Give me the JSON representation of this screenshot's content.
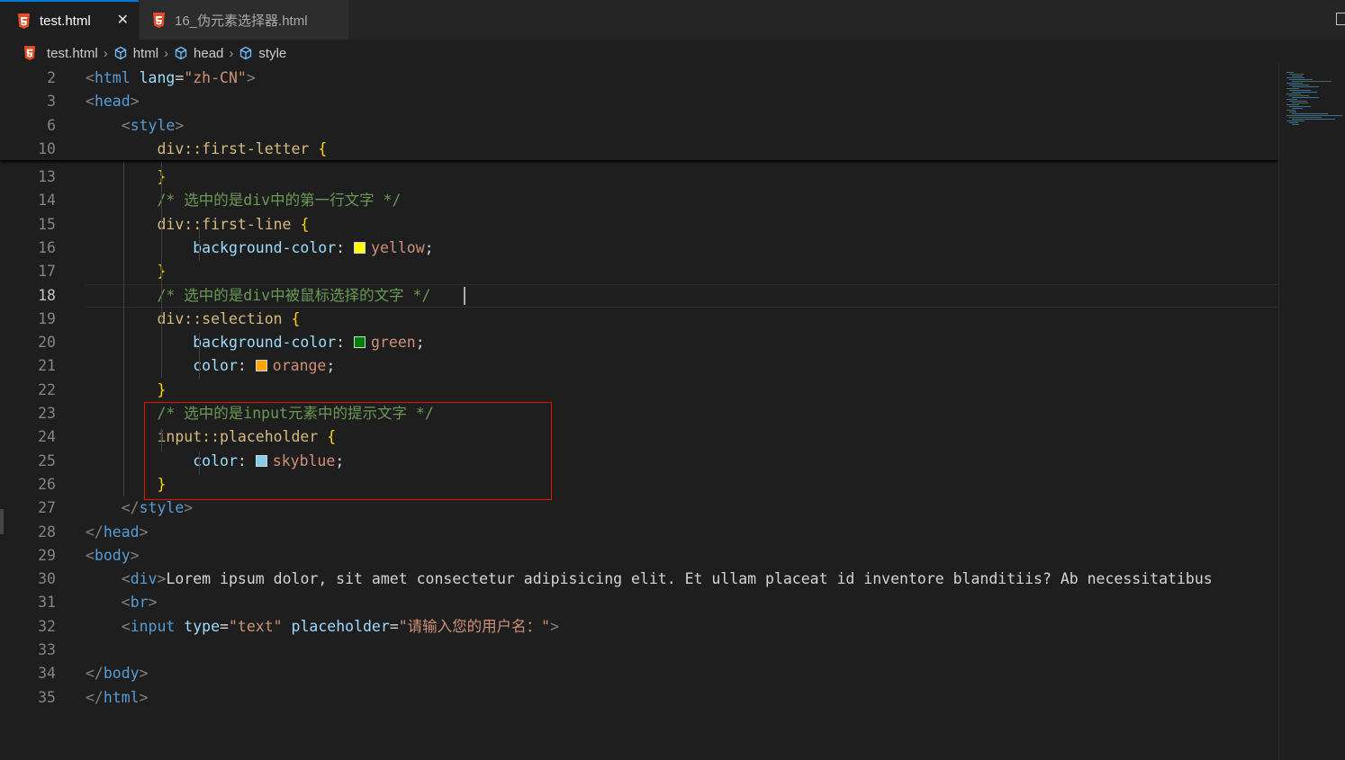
{
  "tabs": [
    {
      "label": "test.html",
      "active": true,
      "close": "✕"
    },
    {
      "label": "16_伪元素选择器.html",
      "active": false
    }
  ],
  "breadcrumb": {
    "file": "test.html",
    "items": [
      "html",
      "head",
      "style"
    ],
    "separator": "›"
  },
  "icons": {
    "file": "html5-icon",
    "symbol": "cube-icon",
    "close": "close-icon",
    "split": "split-editor-icon"
  },
  "colors": {
    "yellow": "#ffff00",
    "green": "#008000",
    "orange": "#ffa500",
    "skyblue": "#87ceeb",
    "accent": "#0078d4",
    "highlight_box": "#e51400"
  },
  "sticky_lines": [
    {
      "n": "2",
      "indent": "",
      "text": "<html lang=\"zh-CN\">"
    },
    {
      "n": "3",
      "indent": "",
      "text": "<head>"
    },
    {
      "n": "6",
      "indent": "    ",
      "text": "<style>"
    },
    {
      "n": "10",
      "indent": "        ",
      "text": "div::first-letter {"
    }
  ],
  "lines": [
    {
      "n": "13",
      "text": "        }"
    },
    {
      "n": "14",
      "text": "        /* 选中的是div中的第一行文字 */"
    },
    {
      "n": "15",
      "text": "        div::first-line {"
    },
    {
      "n": "16",
      "text": "            background-color: yellow;"
    },
    {
      "n": "17",
      "text": "        }"
    },
    {
      "n": "18",
      "text": "        /* 选中的是div中被鼠标选择的文字 */"
    },
    {
      "n": "19",
      "text": "        div::selection {"
    },
    {
      "n": "20",
      "text": "            background-color: green;"
    },
    {
      "n": "21",
      "text": "            color: orange;"
    },
    {
      "n": "22",
      "text": "        }"
    },
    {
      "n": "23",
      "text": "        /* 选中的是input元素中的提示文字 */"
    },
    {
      "n": "24",
      "text": "        input::placeholder {"
    },
    {
      "n": "25",
      "text": "            color: skyblue;"
    },
    {
      "n": "26",
      "text": "        }"
    },
    {
      "n": "27",
      "text": "    </style>"
    },
    {
      "n": "28",
      "text": "</head>"
    },
    {
      "n": "29",
      "text": "<body>"
    },
    {
      "n": "30",
      "text": "    <div>Lorem ipsum dolor, sit amet consectetur adipisicing elit. Et ullam placeat id inventore blanditiis? Ab necessitatibus"
    },
    {
      "n": "31",
      "text": "    <br>"
    },
    {
      "n": "32",
      "text": "    <input type=\"text\" placeholder=\"请输入您的用户名：\">"
    },
    {
      "n": "33",
      "text": ""
    },
    {
      "n": "34",
      "text": "</body>"
    },
    {
      "n": "35",
      "text": "</html>"
    }
  ],
  "current_line": "18"
}
